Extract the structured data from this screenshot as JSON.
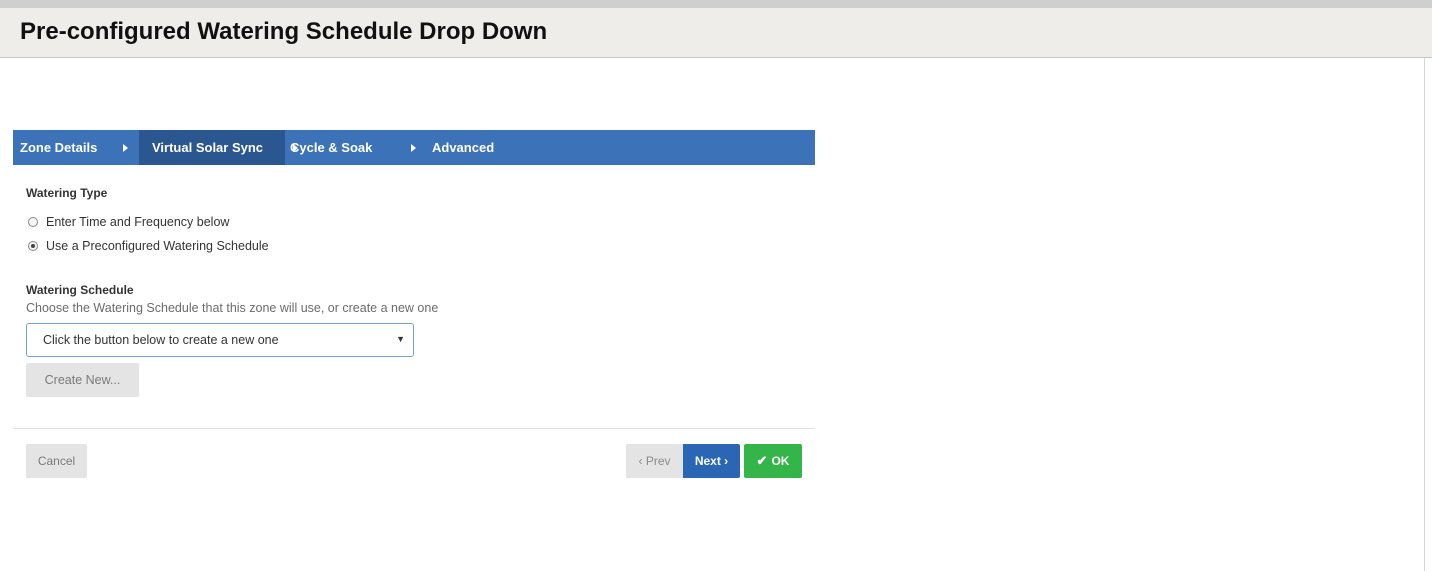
{
  "page": {
    "title": "Pre-configured Watering Schedule Drop Down"
  },
  "wizard": {
    "steps": [
      {
        "label": "Zone Details",
        "active": false
      },
      {
        "label": "Virtual Solar Sync",
        "active": true
      },
      {
        "label": "Cycle & Soak",
        "active": false
      },
      {
        "label": "Advanced",
        "active": false
      }
    ],
    "step_arrow_icon": "caret-right-icon"
  },
  "watering_type": {
    "label": "Watering Type",
    "options": [
      {
        "label": "Enter Time and Frequency below",
        "checked": false
      },
      {
        "label": "Use a Preconfigured Watering Schedule",
        "checked": true
      }
    ]
  },
  "watering_schedule": {
    "label": "Watering Schedule",
    "help": "Choose the Watering Schedule that this zone will use, or create a new one",
    "select_value": "Click the button below to create a new one",
    "caret": "▼",
    "create_button": "Create New..."
  },
  "footer": {
    "cancel": "Cancel",
    "prev": "‹ Prev",
    "next": "Next ›",
    "ok": "OK",
    "ok_icon": "✔"
  },
  "colors": {
    "nav": "#3b72b8",
    "nav_active": "#2a578f",
    "next_button": "#2a66b3",
    "ok_button": "#33b54a"
  }
}
